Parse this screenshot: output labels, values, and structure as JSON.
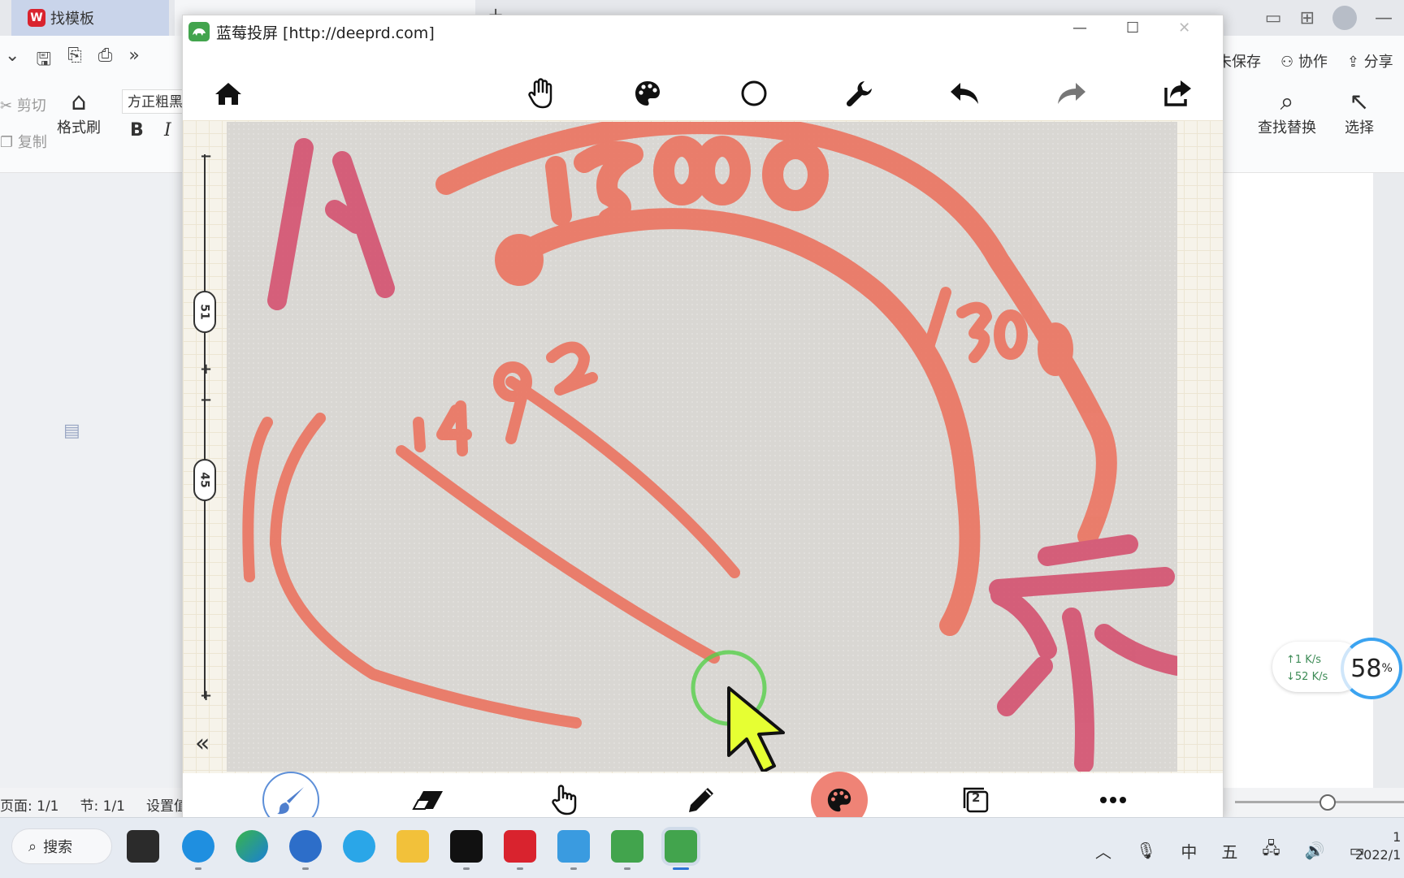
{
  "wps": {
    "tab_template": "找模板",
    "clipboard": {
      "cut": "剪切",
      "copy": "复制"
    },
    "format_brush": "格式刷",
    "font_name": "方正粗黑",
    "bold": "B",
    "italic": "I",
    "top_actions": {
      "save": "未保存",
      "collab": "协作",
      "share": "分享"
    },
    "find_replace": "查找替换",
    "select": "选择",
    "status": {
      "page": "页面: 1/1",
      "section": "节: 1/1",
      "settings": "设置值"
    }
  },
  "net_widget": {
    "up": "↑1  K/s",
    "down": "↓52  K/s",
    "cpu": "58",
    "cpu_unit": "%"
  },
  "app": {
    "title": "蓝莓投屏 [http://deeprd.com]",
    "slider": {
      "top_value": "51",
      "bottom_value": "45"
    },
    "page_count": "2"
  },
  "drawing_text": {
    "a": "A",
    "n1": "1500",
    "n2": "1300",
    "n3": "1492",
    "z": "2"
  },
  "taskbar": {
    "search": "搜索",
    "ime_zh": "中",
    "ime_wu": "五",
    "clock_time": "1",
    "clock_date": "2022/1"
  },
  "colors": {
    "ink_pink": "#d44a6a",
    "ink_orange": "#ec6e5a",
    "accent": "#ef8376"
  }
}
